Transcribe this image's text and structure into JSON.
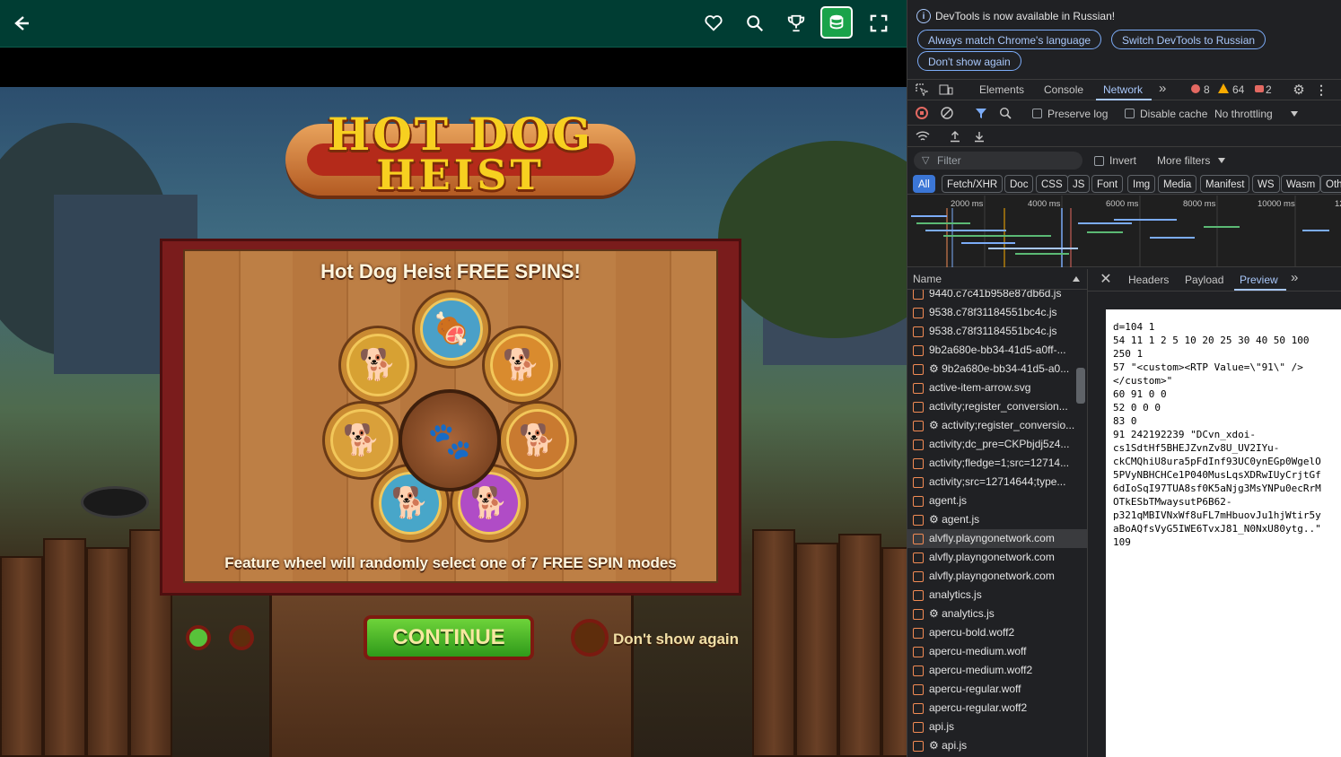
{
  "colors": {
    "topbar": "#003d33",
    "devtools_bg": "#202124",
    "devtools_accent": "#7cacf8",
    "wood": "#b7773e",
    "frame": "#7a1c1c",
    "continue": "#4bb82a"
  },
  "game": {
    "topbar_icons": [
      "back-arrow-icon",
      "heart-icon",
      "search-icon",
      "trophy-icon",
      "coins-icon",
      "fullscreen-icon"
    ],
    "logo": {
      "line1": "HOT DOG",
      "line2": "HEIST"
    },
    "title": "Hot Dog Heist FREE SPINS!",
    "description": "Feature wheel will randomly select one of 7 FREE SPIN modes",
    "medals": [
      "🐕",
      "🍖",
      "🐕",
      "🐕",
      "🐕",
      "🐕",
      "🐕"
    ],
    "wheel_center_icon": "🐾",
    "page_dots": [
      {
        "active": true
      },
      {
        "active": false
      }
    ],
    "continue_label": "CONTINUE",
    "dont_show_label": "Don't show again"
  },
  "devtools": {
    "infobar": {
      "message": "DevTools is now available in Russian!",
      "buttons": [
        "Always match Chrome's language",
        "Switch DevTools to Russian",
        "Don't show again"
      ]
    },
    "tabs": [
      "Elements",
      "Console",
      "Network"
    ],
    "active_tab": "Network",
    "counts": {
      "errors": "8",
      "warnings": "64",
      "issues": "2"
    },
    "toolbar": {
      "preserve_log": "Preserve log",
      "disable_cache": "Disable cache",
      "throttling": "No throttling"
    },
    "filter": {
      "placeholder": "Filter",
      "invert": "Invert",
      "more_filters": "More filters"
    },
    "type_filters": [
      "All",
      "Fetch/XHR",
      "Doc",
      "CSS",
      "JS",
      "Font",
      "Img",
      "Media",
      "Manifest",
      "WS",
      "Wasm",
      "Oth"
    ],
    "timeline_ticks": [
      "2000 ms",
      "4000 ms",
      "6000 ms",
      "8000 ms",
      "10000 ms",
      "12"
    ],
    "list_header": "Name",
    "requests": [
      "9440.c7c41b958e87db6d.js",
      "9538.c78f31184551bc4c.js",
      "9538.c78f31184551bc4c.js",
      "9b2a680e-bb34-41d5-a0ff-...",
      "⚙ 9b2a680e-bb34-41d5-a0...",
      "active-item-arrow.svg",
      "activity;register_conversion...",
      "⚙ activity;register_conversio...",
      "activity;dc_pre=CKPbjdj5z4...",
      "activity;fledge=1;src=12714...",
      "activity;src=12714644;type...",
      "agent.js",
      "⚙ agent.js",
      "alvfly.playngonetwork.com",
      "alvfly.playngonetwork.com",
      "alvfly.playngonetwork.com",
      "analytics.js",
      "⚙ analytics.js",
      "apercu-bold.woff2",
      "apercu-medium.woff",
      "apercu-medium.woff2",
      "apercu-regular.woff",
      "apercu-regular.woff2",
      "api.js",
      "⚙ api.js"
    ],
    "detail_tabs": [
      "Headers",
      "Payload",
      "Preview"
    ],
    "active_detail_tab": "Preview",
    "preview_text": "d=104 1\n54 11 1 2 5 10 20 25 30 40 50 100\n250 1\n57 \"<custom><RTP Value=\\\"91\\\" />\n</custom>\"\n60 91 0 0\n52 0 0 0\n83 0\n91 242192239 \"DCvn_xdoi-\ncs1SdtHf5BHEJZvnZv8U_UV2IYu-\nckCMQhiU8ura5pFdInf93UC0ynEGp0WgelO\n5PVyNBHCHCe1P040MusLqsXDRwIUyCrjtGf\n6dIoSqI97TUA8sf0K5aNjg3MsYNPu0ecRrM\nOTkESbTMwaysutP6B62-\np321qMBIVNxWf8uFL7mHbuovJu1hjWtir5y\naBoAQfsVyG5IWE6TvxJ81_N0NxU80ytg..\"\n109"
  }
}
